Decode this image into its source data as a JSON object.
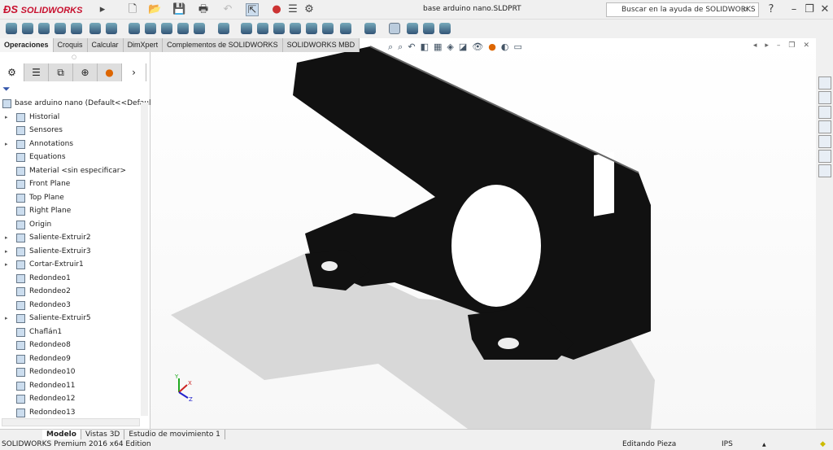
{
  "app": {
    "logo": "SOLIDWORKS",
    "document_title": "base arduino nano.SLDPRT",
    "help_search_placeholder": "Buscar en la ayuda de SOLIDWORKS",
    "help_label": "?"
  },
  "command_tabs": [
    "Operaciones",
    "Croquis",
    "Calcular",
    "DimXpert",
    "Complementos de SOLIDWORKS",
    "SOLIDWORKS MBD"
  ],
  "tree": {
    "root": "base arduino nano  (Default<<Default>",
    "items": [
      {
        "label": "Historial",
        "expandable": true
      },
      {
        "label": "Sensores",
        "expandable": false
      },
      {
        "label": "Annotations",
        "expandable": true
      },
      {
        "label": "Equations",
        "expandable": false
      },
      {
        "label": "Material <sin especificar>",
        "expandable": false
      },
      {
        "label": "Front Plane",
        "expandable": false
      },
      {
        "label": "Top Plane",
        "expandable": false
      },
      {
        "label": "Right Plane",
        "expandable": false
      },
      {
        "label": "Origin",
        "expandable": false
      },
      {
        "label": "Saliente-Extruir2",
        "expandable": true
      },
      {
        "label": "Saliente-Extruir3",
        "expandable": true
      },
      {
        "label": "Cortar-Extruir1",
        "expandable": true
      },
      {
        "label": "Redondeo1",
        "expandable": false
      },
      {
        "label": "Redondeo2",
        "expandable": false
      },
      {
        "label": "Redondeo3",
        "expandable": false
      },
      {
        "label": "Saliente-Extruir5",
        "expandable": true
      },
      {
        "label": "Chaflán1",
        "expandable": false
      },
      {
        "label": "Redondeo8",
        "expandable": false
      },
      {
        "label": "Redondeo9",
        "expandable": false
      },
      {
        "label": "Redondeo10",
        "expandable": false
      },
      {
        "label": "Redondeo11",
        "expandable": false
      },
      {
        "label": "Redondeo12",
        "expandable": false
      },
      {
        "label": "Redondeo13",
        "expandable": false
      }
    ]
  },
  "bottom_tabs": [
    "Modelo",
    "Vistas 3D",
    "Estudio de movimiento 1"
  ],
  "status": {
    "edition": "SOLIDWORKS Premium 2016 x64 Edition",
    "mode": "Editando Pieza",
    "units": "IPS"
  },
  "triad": {
    "x": "X",
    "y": "Y",
    "z": "Z"
  },
  "colors": {
    "brand": "#c8102e",
    "part": "#111111"
  }
}
